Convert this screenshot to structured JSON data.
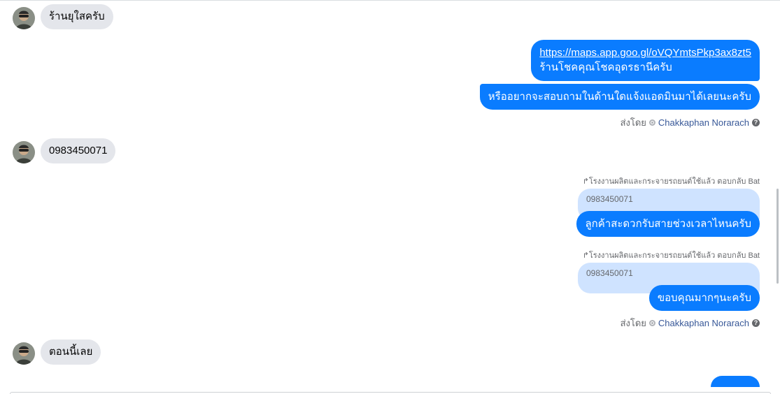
{
  "messages": {
    "m1_in": "ร้านยุใสครับ",
    "m2_out_link": "https://maps.app.goo.gl/oVQYmtsPkp3ax8zt5",
    "m2_out_text": "ร้านโชคคุณโชคอุดรธานีครับ",
    "m3_out": "หรืออยากจะสอบถามในด้านใดแจ้งแอดมินมาได้เลยนะครับ",
    "m4_in": "0983450071",
    "m5_out": "ลูกค้าสะดวกรับสายช่วงเวลาไหนครับ",
    "m6_out": "ขอบคุณมากๆนะครับ",
    "m7_in": "ตอนนี้เลย"
  },
  "sent_by": {
    "label": "ส่งโดย",
    "name": "Chakkaphan Norarach"
  },
  "reply": {
    "hint": "โรงงานผลิตและกระจายรถยนต์ใช้แล้ว ตอบกลับ Bat",
    "quoted": "0983450071"
  },
  "colors": {
    "outgoing": "#0a7cff",
    "incoming": "#e4e6eb",
    "quote": "#cfe3ff"
  },
  "icons": {
    "avatar": "user-avatar",
    "reply": "reply-arrow-icon",
    "help": "question-icon"
  }
}
